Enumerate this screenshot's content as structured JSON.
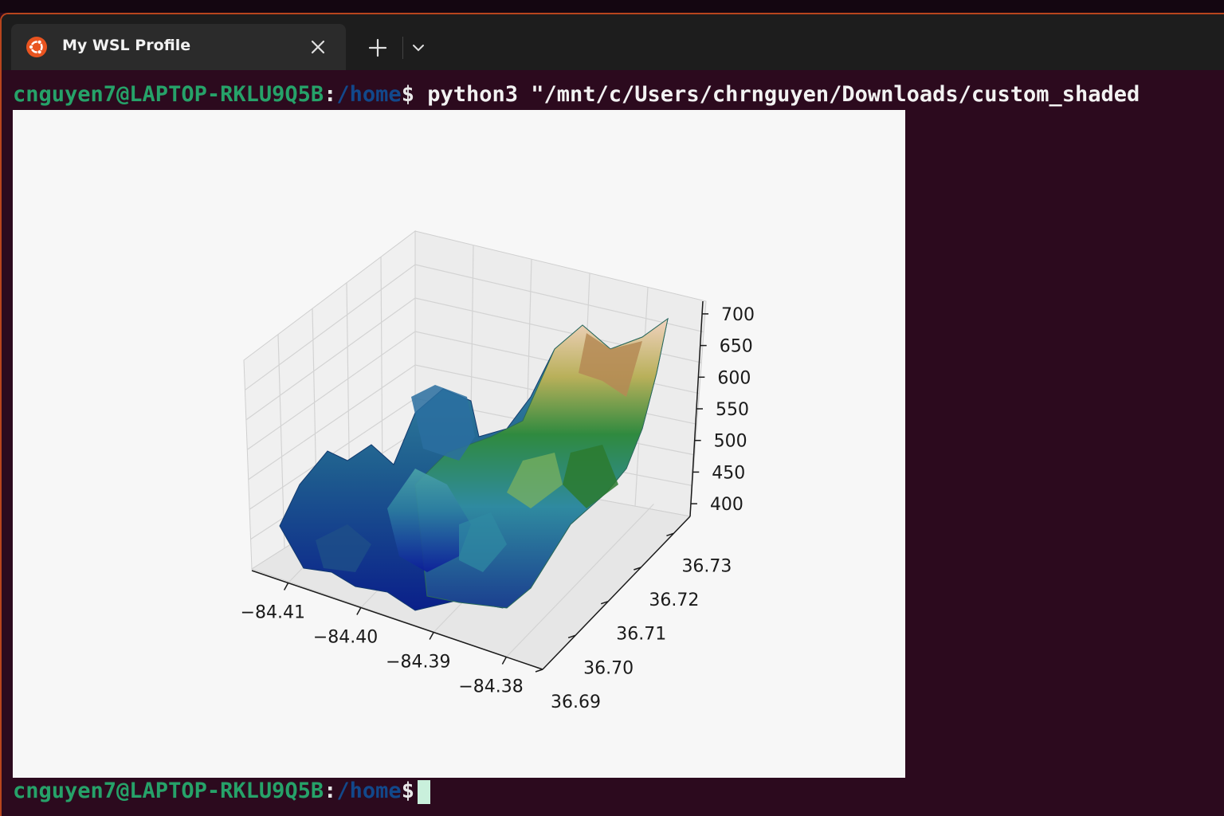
{
  "app": {
    "tab_title": "My WSL Profile",
    "accent_color": "#e95420",
    "icons": [
      "ubuntu-icon",
      "close-icon",
      "plus-icon",
      "chevron-down-icon"
    ]
  },
  "terminal": {
    "line1": {
      "user": "cnguyen7@LAPTOP-RKLU9Q5B",
      "colon": ":",
      "path": "/home",
      "dollar": "$",
      "command": " python3 \"/mnt/c/Users/chrnguyen/Downloads/custom_shaded"
    },
    "line2": {
      "user": "cnguyen7@LAPTOP-RKLU9Q5B",
      "colon": ":",
      "path": "/home",
      "dollar": "$"
    }
  },
  "chart_data": {
    "type": "surface3d",
    "colormap": "gist_earth",
    "x_ticks": [
      "−84.41",
      "−84.40",
      "−84.39",
      "−84.38"
    ],
    "y_ticks": [
      "36.69",
      "36.70",
      "36.71",
      "36.72",
      "36.73"
    ],
    "z_ticks": [
      "400",
      "450",
      "500",
      "550",
      "600",
      "650",
      "700"
    ],
    "x_range": [
      -84.415,
      -84.375
    ],
    "y_range": [
      36.69,
      36.735
    ],
    "z_range": [
      380,
      720
    ],
    "grid": true
  }
}
